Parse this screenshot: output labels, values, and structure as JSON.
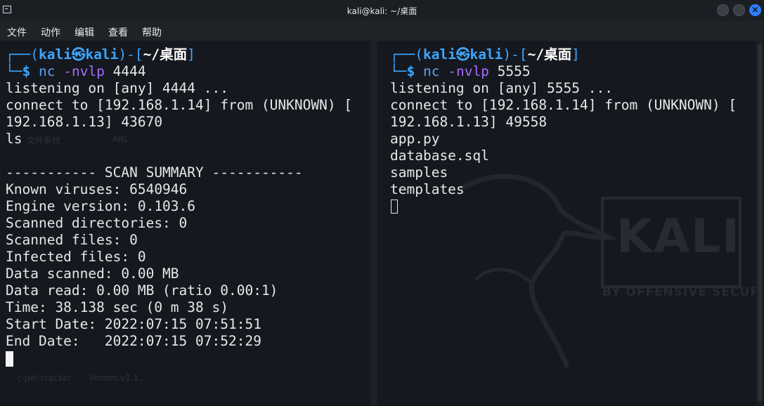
{
  "window": {
    "title": "kali@kali: ~/桌面"
  },
  "menu": [
    "文件",
    "动作",
    "编辑",
    "查看",
    "帮助"
  ],
  "left_pane": {
    "prompt": {
      "user": "kali",
      "at_symbol": "㉿",
      "host": "kali",
      "path": "~/桌面",
      "dollar": "$"
    },
    "command": {
      "cmd": "nc",
      "option": "-nvlp",
      "arg": "4444"
    },
    "output": [
      "listening on [any] 4444 ...",
      "connect to [192.168.1.14] from (UNKNOWN) [",
      "192.168.1.13] 43670",
      "ls",
      "",
      "----------- SCAN SUMMARY -----------",
      "Known viruses: 6540946",
      "Engine version: 0.103.6",
      "Scanned directories: 0",
      "Scanned files: 0",
      "Infected files: 0",
      "Data scanned: 0.00 MB",
      "Data read: 0.00 MB (ratio 0.00:1)",
      "Time: 38.138 sec (0 m 38 s)",
      "Start Date: 2022:07:15 07:51:51",
      "End Date:   2022:07:15 07:52:29"
    ],
    "background_labels": [
      "文件系统",
      "ARL",
      "c-jwt-cracker",
      "Venom.v1.1..."
    ]
  },
  "right_pane": {
    "prompt": {
      "user": "kali",
      "at_symbol": "㉿",
      "host": "kali",
      "path": "~/桌面",
      "dollar": "$"
    },
    "command": {
      "cmd": "nc",
      "option": "-nvlp",
      "arg": "5555"
    },
    "output": [
      "listening on [any] 5555 ...",
      "connect to [192.168.1.14] from (UNKNOWN) [",
      "192.168.1.13] 49558",
      "app.py",
      "database.sql",
      "samples",
      "templates"
    ],
    "watermark": {
      "text": "KALI",
      "subtitle": "BY OFFENSIVE SECURITY"
    }
  },
  "colors": {
    "accent": "#3ea7ff",
    "command": "#5aa1ff",
    "option": "#a66bff",
    "background": "#15181e",
    "text": "#e7e7e7"
  }
}
